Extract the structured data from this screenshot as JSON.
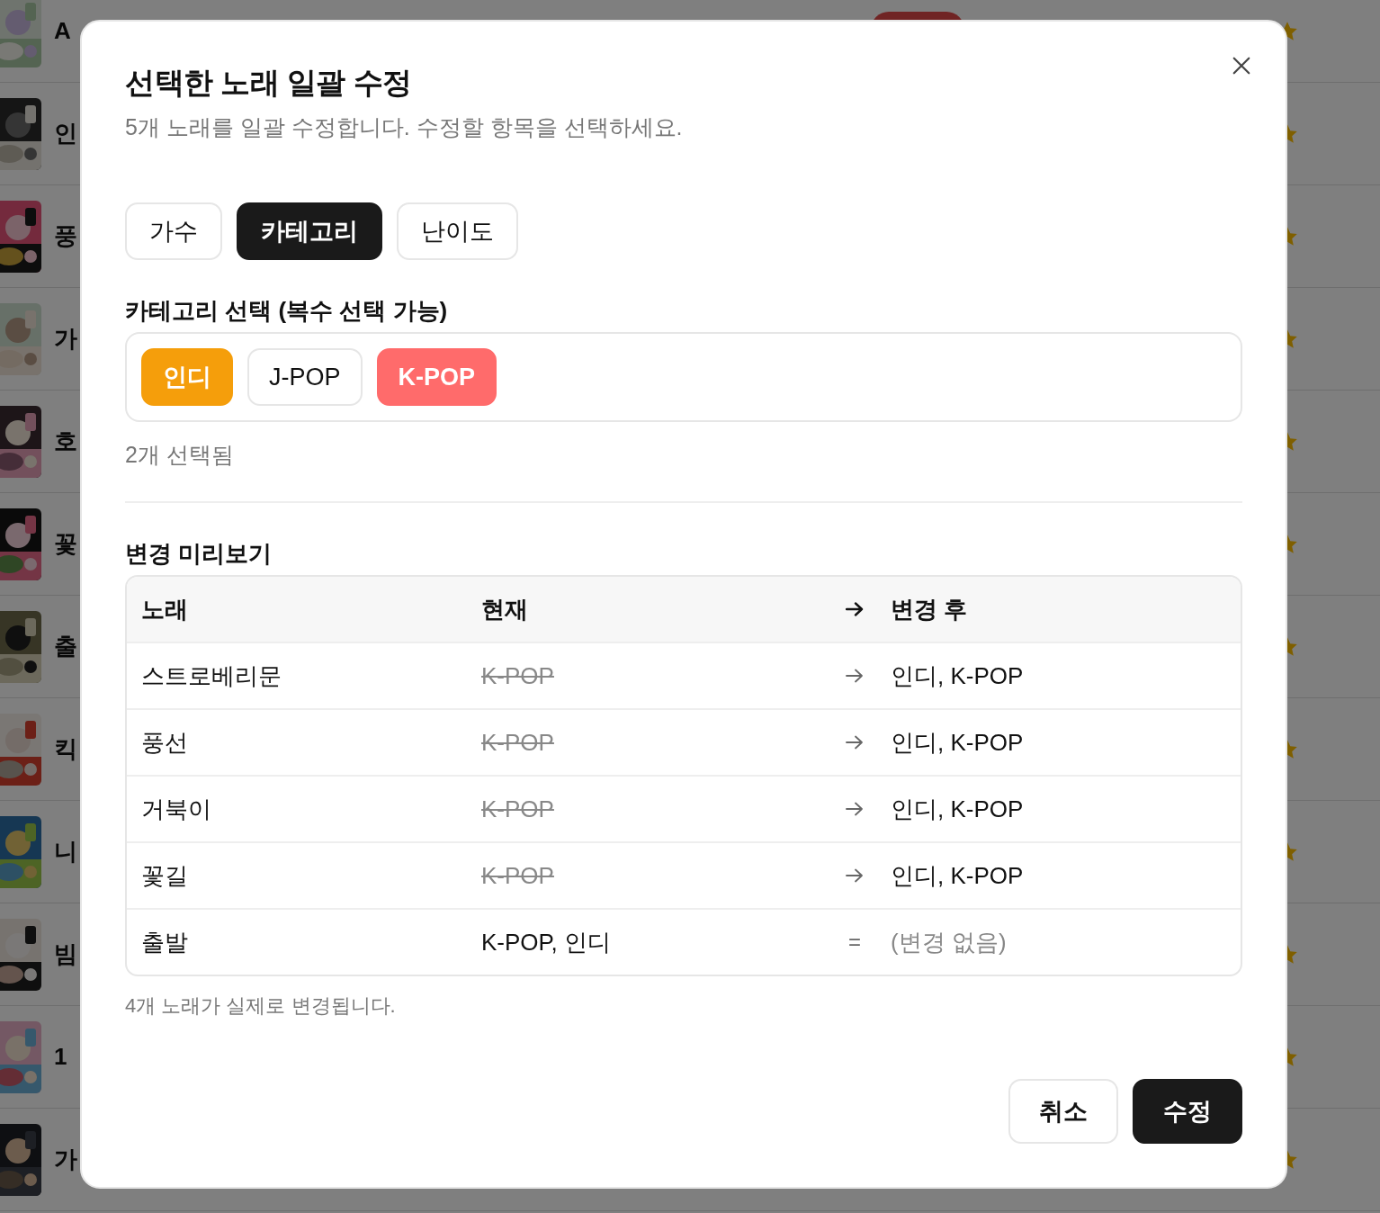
{
  "background_list": {
    "rows": [
      {
        "title": "A",
        "tagged": true
      },
      {
        "title": "인",
        "tagged": false
      },
      {
        "title": "풍",
        "tagged": false
      },
      {
        "title": "가",
        "tagged": false
      },
      {
        "title": "호",
        "tagged": false
      },
      {
        "title": "꽃",
        "tagged": false
      },
      {
        "title": "출",
        "tagged": false
      },
      {
        "title": "킥",
        "tagged": false
      },
      {
        "title": "니",
        "tagged": false
      },
      {
        "title": "빔",
        "tagged": false
      },
      {
        "title": "1",
        "tagged": false
      },
      {
        "title": "가",
        "tagged": false
      }
    ]
  },
  "dialog": {
    "title": "선택한 노래 일괄 수정",
    "subtitle": "5개 노래를 일괄 수정합니다. 수정할 항목을 선택하세요.",
    "tabs": [
      {
        "label": "가수",
        "selected": false
      },
      {
        "label": "카테고리",
        "selected": true
      },
      {
        "label": "난이도",
        "selected": false
      }
    ],
    "category_label": "카테고리 선택 (복수 선택 가능)",
    "categories": [
      {
        "label": "인디",
        "selected": true,
        "color": "#f59e0b"
      },
      {
        "label": "J-POP",
        "selected": false
      },
      {
        "label": "K-POP",
        "selected": true,
        "color": "#ff6b6b"
      }
    ],
    "selected_count": "2개 선택됨",
    "preview_title": "변경 미리보기",
    "preview_table": {
      "columns": [
        "노래",
        "현재",
        "변경 후"
      ],
      "rows": [
        {
          "song": "스트로베리문",
          "current": "K-POP",
          "changed": true,
          "after": "인디, K-POP"
        },
        {
          "song": "풍선",
          "current": "K-POP",
          "changed": true,
          "after": "인디, K-POP"
        },
        {
          "song": "거북이",
          "current": "K-POP",
          "changed": true,
          "after": "인디, K-POP"
        },
        {
          "song": "꽃길",
          "current": "K-POP",
          "changed": true,
          "after": "인디, K-POP"
        },
        {
          "song": "출발",
          "current": "K-POP, 인디",
          "changed": false,
          "marker": "=",
          "after": "(변경 없음)"
        }
      ]
    },
    "note": "4개 노래가 실제로 변경됩니다.",
    "buttons": [
      {
        "label": "취소",
        "kind": "secondary"
      },
      {
        "label": "수정",
        "kind": "primary"
      }
    ]
  }
}
